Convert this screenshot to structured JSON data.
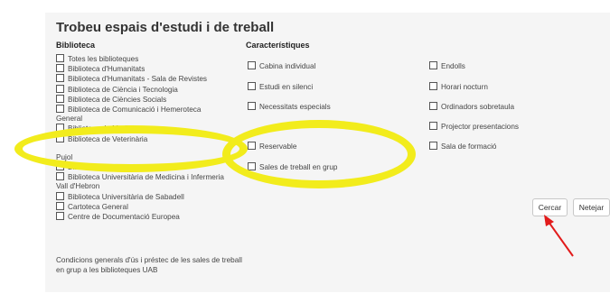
{
  "page": {
    "title": "Trobeu espais d'estudi i de treball",
    "library_heading": "Biblioteca",
    "features_heading": "Característiques"
  },
  "libraries": [
    "Totes les biblioteques",
    "Biblioteca d'Humanitats",
    "Biblioteca d'Humanitats - Sala de Revistes",
    "Biblioteca de Ciència i Tecnologia",
    "Biblioteca de Ciències Socials",
    "Biblioteca de Comunicació i Hemeroteca",
    "General",
    "Biblioteca de Medicina",
    "Biblioteca de Veterinària",
    "Pujol",
    "Biblioteca Josep Laporte",
    "Biblioteca Universitària de Medicina i Infermeria",
    "Vall d'Hebron",
    "Biblioteca Universitària de Sabadell",
    "Cartoteca General",
    "Centre de Documentació Europea"
  ],
  "features_col1": [
    "Cabina individual",
    "Estudi en silenci",
    "Necessitats especials",
    "Reservable",
    "Sales de treball en grup"
  ],
  "features_col2": [
    "Endolls",
    "Horari nocturn",
    "Ordinadors sobretaula",
    "Projector presentacions",
    "Sala de formació"
  ],
  "note": "Condicions generals d'ús i préstec de les sales de treball en grup a les biblioteques UAB",
  "buttons": {
    "search": "Cercar",
    "clear": "Netejar"
  },
  "colors": {
    "highlight": "#f2ec1c",
    "arrow": "#e21b1b",
    "panel_bg": "#f5f5f5"
  }
}
